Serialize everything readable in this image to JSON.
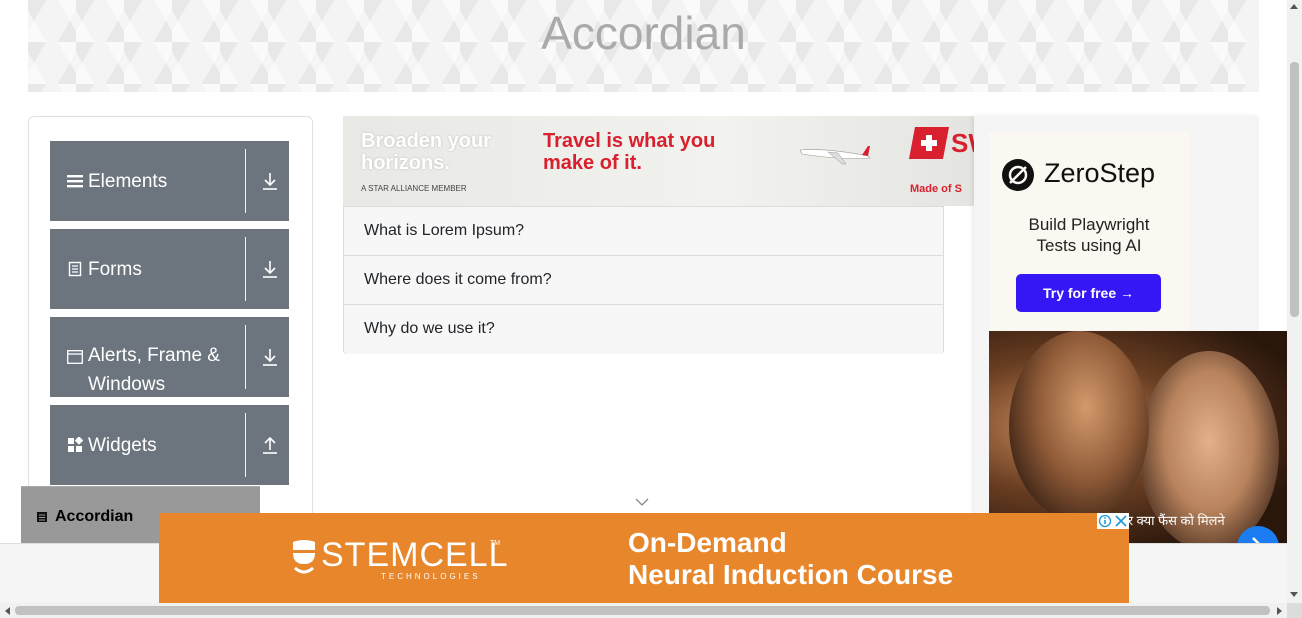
{
  "page": {
    "title": "Accordian"
  },
  "sidebar": {
    "groups": [
      {
        "label": "Elements",
        "icon": "menu-icon",
        "arrow": "download-icon"
      },
      {
        "label": "Forms",
        "icon": "document-icon",
        "arrow": "download-icon"
      },
      {
        "label": "Alerts, Frame & Windows",
        "icon": "window-icon",
        "arrow": "download-icon"
      },
      {
        "label": "Widgets",
        "icon": "widgets-icon",
        "arrow": "upload-icon"
      }
    ],
    "active_item": {
      "label": "Accordian",
      "icon": "doc-icon"
    }
  },
  "top_ad": {
    "headline_left": "Broaden your horizons.",
    "headline_right": "Travel is what you make of it.",
    "footer": "A STAR ALLIANCE MEMBER",
    "brand": "SW",
    "tagline": "Made of S"
  },
  "accordion": {
    "items": [
      {
        "label": "What is Lorem Ipsum?"
      },
      {
        "label": "Where does it come from?"
      },
      {
        "label": "Why do we use it?"
      }
    ]
  },
  "zerostep_ad": {
    "name": "ZeroStep",
    "desc_line1": "Build Playwright",
    "desc_line2": "Tests using AI",
    "cta": "Try for free →"
  },
  "movie_ad": {
    "caption": "ें पर क्या फैंस को मिलने"
  },
  "bottom_ad": {
    "brand": "STEMCELL",
    "tm": "TM",
    "tagline": "TECHNOLOGIES",
    "headline_line1": "On-Demand",
    "headline_line2": "Neural Induction Course"
  },
  "colors": {
    "sidebar_group": "#6c757d",
    "ad_orange": "#e7862a",
    "cta_blue": "#3517f5",
    "swiss_red": "#d8202e"
  }
}
